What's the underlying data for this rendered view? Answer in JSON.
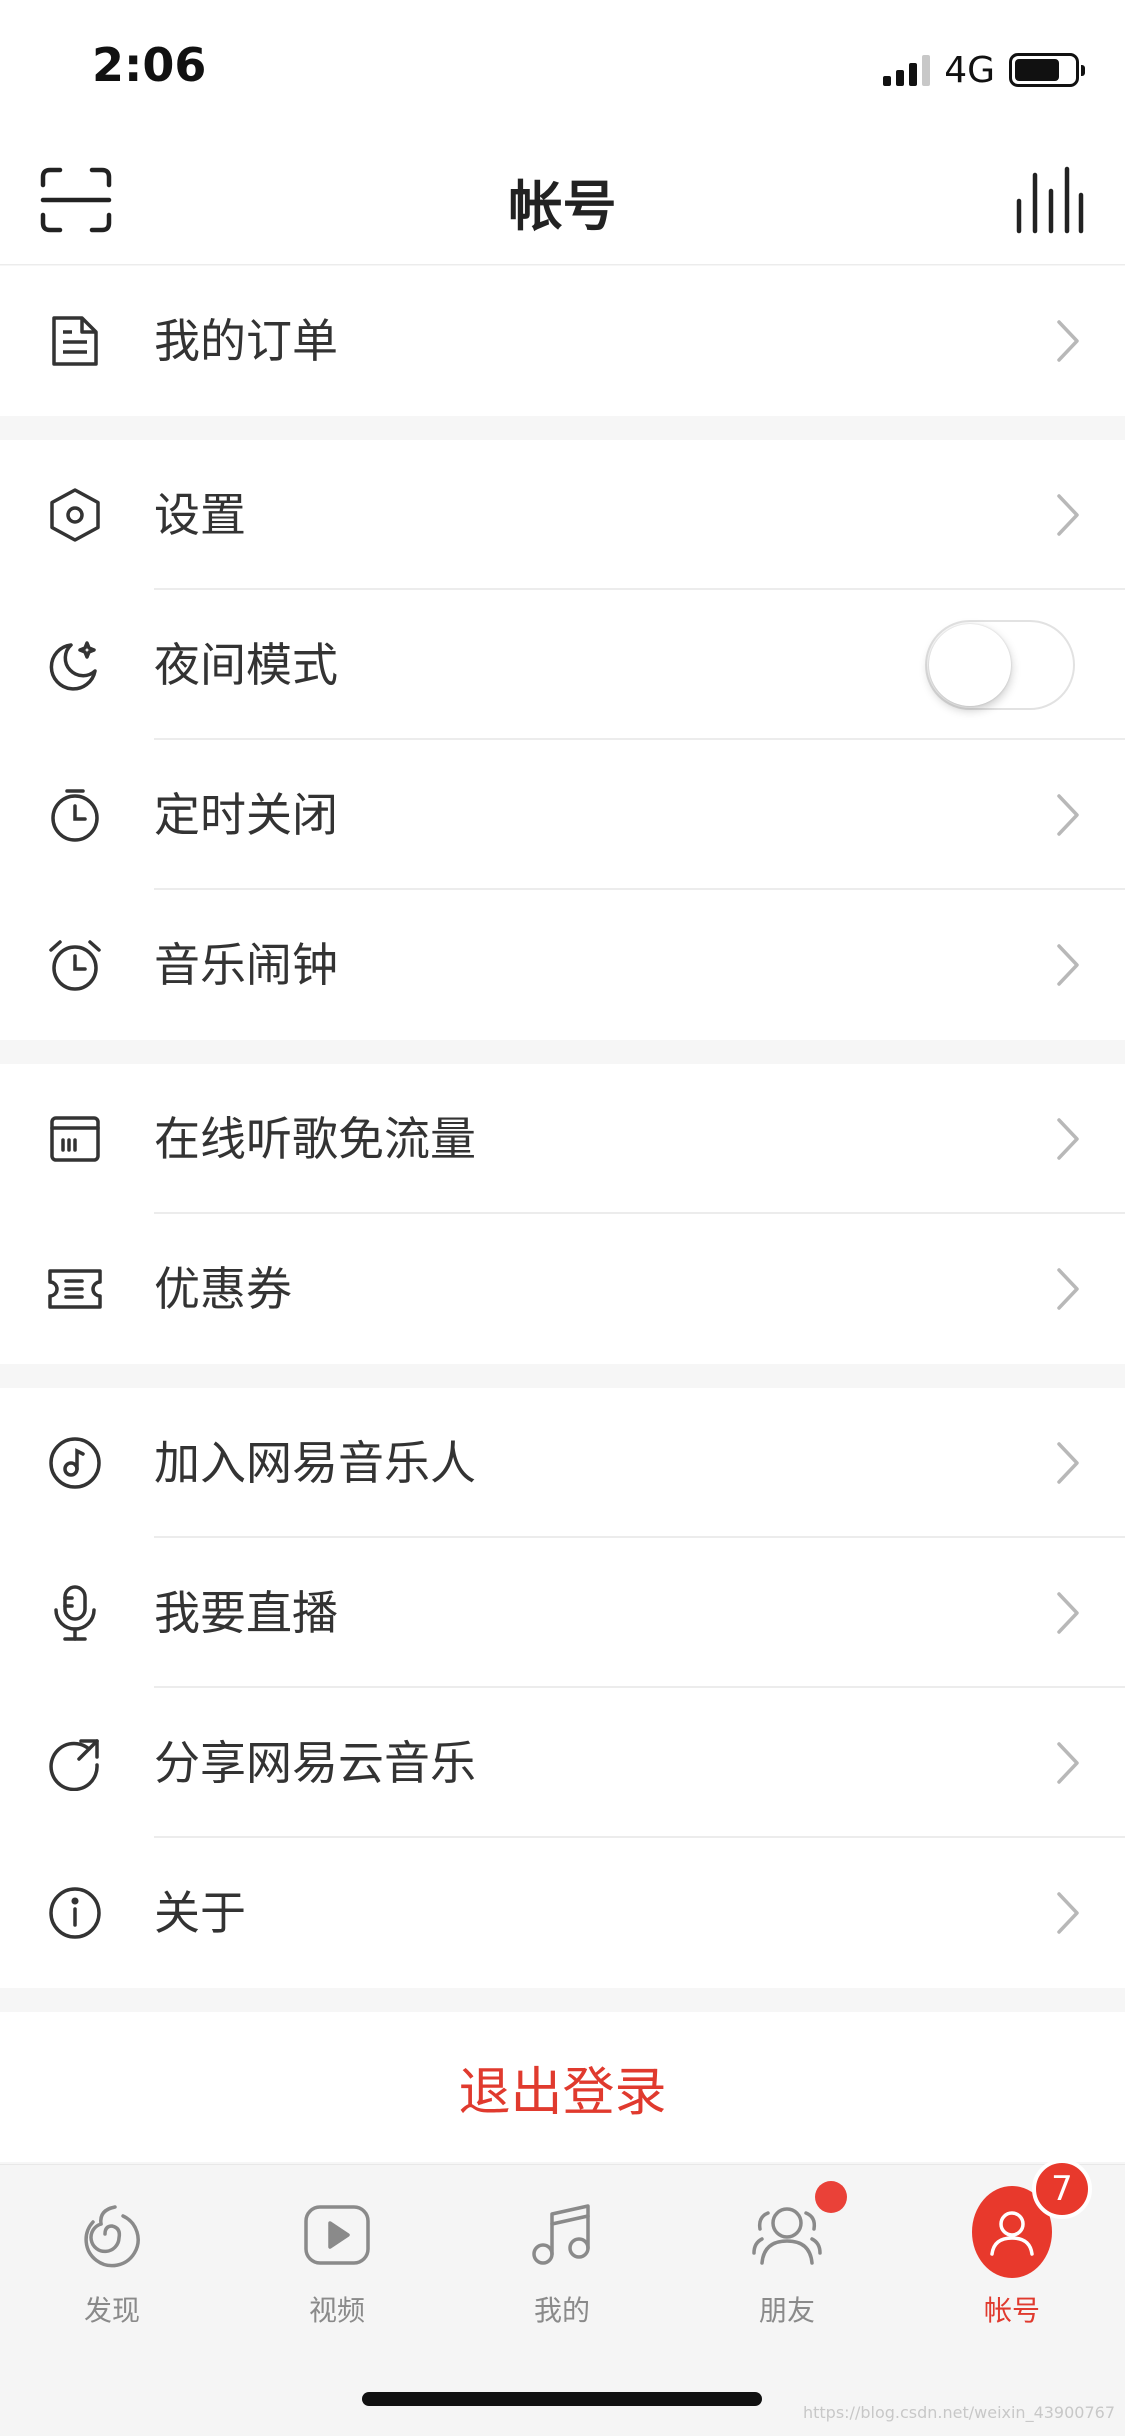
{
  "status": {
    "time": "2:06",
    "network": "4G"
  },
  "header": {
    "title": "帐号",
    "scan_icon": "scan-icon",
    "equalizer_icon": "equalizer-icon"
  },
  "groups": [
    {
      "items": [
        {
          "label": "我的订单",
          "icon": "order-icon"
        }
      ]
    },
    {
      "items": [
        {
          "label": "设置",
          "icon": "settings-icon"
        },
        {
          "label": "夜间模式",
          "icon": "night-mode-icon",
          "toggle": false
        },
        {
          "label": "定时关闭",
          "icon": "timer-icon"
        },
        {
          "label": "音乐闹钟",
          "icon": "alarm-icon"
        }
      ]
    },
    {
      "items": [
        {
          "label": "在线听歌免流量",
          "icon": "data-free-icon"
        },
        {
          "label": "优惠券",
          "icon": "coupon-icon"
        }
      ]
    },
    {
      "items": [
        {
          "label": "加入网易音乐人",
          "icon": "musician-icon"
        },
        {
          "label": "我要直播",
          "icon": "microphone-icon"
        },
        {
          "label": "分享网易云音乐",
          "icon": "share-icon"
        },
        {
          "label": "关于",
          "icon": "info-icon"
        }
      ]
    }
  ],
  "logout": {
    "label": "退出登录",
    "color": "#e03a2e"
  },
  "tabs": [
    {
      "label": "发现",
      "icon": "discover-icon"
    },
    {
      "label": "视频",
      "icon": "video-icon"
    },
    {
      "label": "我的",
      "icon": "music-note-icon"
    },
    {
      "label": "朋友",
      "icon": "friends-icon",
      "dot": true
    },
    {
      "label": "帐号",
      "icon": "account-icon",
      "active": true,
      "badge": "7"
    }
  ],
  "accent_color": "#e8392c",
  "watermark": "https://blog.csdn.net/weixin_43900767"
}
